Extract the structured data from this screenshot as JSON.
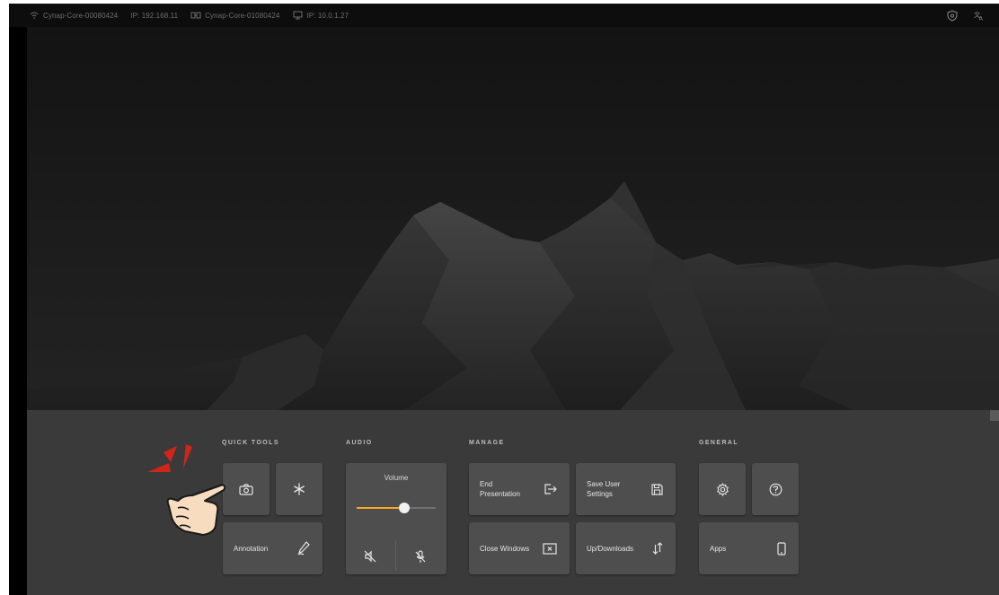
{
  "topbar": {
    "device1_name": "Cynap-Core-00080424",
    "device1_ip": "IP: 192.168.11",
    "device2_name": "Cynap-Core-01080424",
    "device2_ip": "IP: 10.0.1.27",
    "icons": [
      "wifi-icon",
      "device-link-icon",
      "network-icon",
      "shield-icon",
      "language-icon"
    ]
  },
  "sections": {
    "quick_tools": "QUICK TOOLS",
    "audio": "AUDIO",
    "manage": "MANAGE",
    "general": "GENERAL"
  },
  "quick_tools": {
    "screenshot_icon": "camera-icon",
    "freeze_icon": "snowflake-icon",
    "annotation_label": "Annotation"
  },
  "audio": {
    "volume_label": "Volume",
    "volume_level": 0.6,
    "mute_icon": "speaker-mute-icon",
    "mic_mute_icon": "mic-mute-icon"
  },
  "manage": {
    "end_presentation_label": "End Presentation",
    "save_user_settings_label": "Save User Settings",
    "close_windows_label": "Close Windows",
    "up_downloads_label": "Up/Downloads"
  },
  "general": {
    "settings_icon": "gear-icon",
    "help_icon": "help-icon",
    "apps_label": "Apps"
  },
  "colors": {
    "accent": "#f5a623",
    "panel": "#3a3a3a",
    "tile": "#4e4e4e",
    "hint_red": "#d0251a"
  }
}
